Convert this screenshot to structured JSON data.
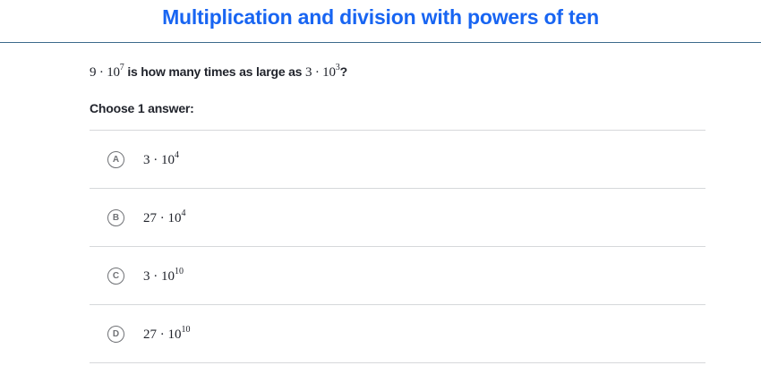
{
  "header": {
    "title": "Multiplication and division with powers of ten"
  },
  "question": {
    "a_base": "9 · 10",
    "a_exp": "7",
    "text": "is how many times as large as",
    "b_base": "3 · 10",
    "b_exp": "3",
    "suffix": "?"
  },
  "choose_label": "Choose 1 answer:",
  "choices": [
    {
      "letter": "A",
      "base": "3 · 10",
      "exp": "4"
    },
    {
      "letter": "B",
      "base": "27 · 10",
      "exp": "4"
    },
    {
      "letter": "C",
      "base": "3 · 10",
      "exp": "10"
    },
    {
      "letter": "D",
      "base": "27 · 10",
      "exp": "10"
    }
  ],
  "colors": {
    "title": "#1865f2",
    "text": "#21242c",
    "divider": "#d6d8da",
    "choice_letter": "#707276"
  }
}
